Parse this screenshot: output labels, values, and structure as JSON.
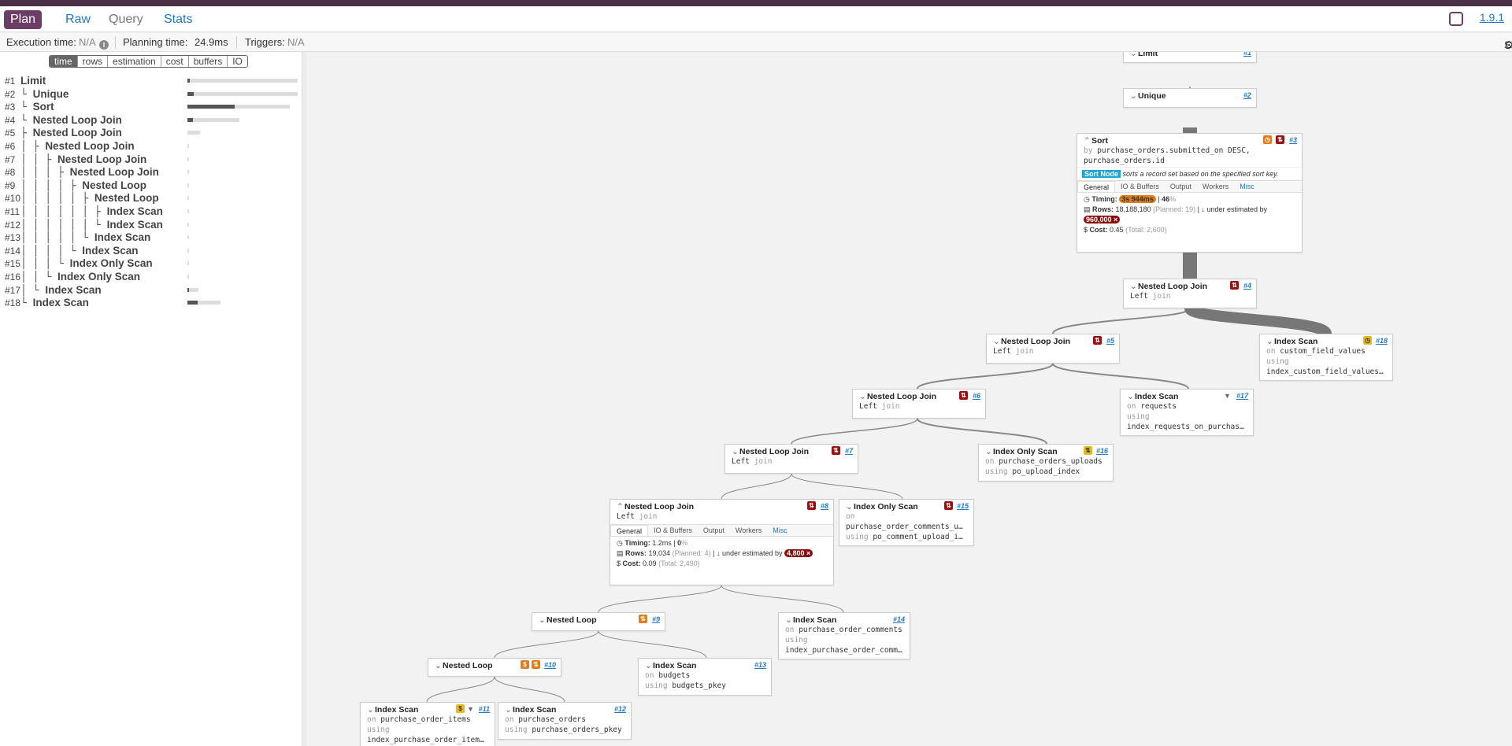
{
  "nav": {
    "tabs": [
      "Plan",
      "Raw",
      "Query",
      "Stats"
    ],
    "version": "1.9.1"
  },
  "info": {
    "exec_label": "Execution time:",
    "exec_value": "N/A",
    "plan_label": "Planning time:",
    "plan_value": "24.9ms",
    "trig_label": "Triggers:",
    "trig_value": "N/A",
    "settings": "Settings"
  },
  "metrics": [
    "time",
    "rows",
    "estimation",
    "cost",
    "buffers",
    "IO"
  ],
  "tree": [
    {
      "n": "#1",
      "label": "Limit",
      "guide": "",
      "fill": 0.02
    },
    {
      "n": "#2",
      "label": "Unique",
      "guide": "└ ",
      "fill": 0.06
    },
    {
      "n": "#3",
      "label": "Sort",
      "guide": "  └ ",
      "fill": 0.46
    },
    {
      "n": "#4",
      "label": "Nested Loop Join",
      "guide": "    └ ",
      "fill": 0.1
    },
    {
      "n": "#5",
      "label": "Nested Loop Join",
      "guide": "      ├ ",
      "fill": 0.0
    },
    {
      "n": "#6",
      "label": "Nested Loop Join",
      "guide": "      │ ├ ",
      "fill": 0.0
    },
    {
      "n": "#7",
      "label": "Nested Loop Join",
      "guide": "      │ │ ├ ",
      "fill": 0.0
    },
    {
      "n": "#8",
      "label": "Nested Loop Join",
      "guide": "      │ │ │ ├ ",
      "fill": 0.0
    },
    {
      "n": "#9",
      "label": "Nested Loop",
      "guide": "      │ │ │ │ ├ ",
      "fill": 0.0
    },
    {
      "n": "#10",
      "label": "Nested Loop",
      "guide": "      │ │ │ │ │ ├ ",
      "fill": 0.0
    },
    {
      "n": "#11",
      "label": "Index Scan",
      "guide": "      │ │ │ │ │ │ ├ ",
      "fill": 0.0
    },
    {
      "n": "#12",
      "label": "Index Scan",
      "guide": "      │ │ │ │ │ │ └ ",
      "fill": 0.0
    },
    {
      "n": "#13",
      "label": "Index Scan",
      "guide": "      │ │ │ │ │ └ ",
      "fill": 0.0
    },
    {
      "n": "#14",
      "label": "Index Scan",
      "guide": "      │ │ │ │ └ ",
      "fill": 0.0
    },
    {
      "n": "#15",
      "label": "Index Only Scan",
      "guide": "      │ │ │ └ ",
      "fill": 0.0
    },
    {
      "n": "#16",
      "label": "Index Only Scan",
      "guide": "      │ │ └ ",
      "fill": 0.0
    },
    {
      "n": "#17",
      "label": "Index Scan",
      "guide": "      │ └ ",
      "fill": 0.12
    },
    {
      "n": "#18",
      "label": "Index Scan",
      "guide": "      └ ",
      "fill": 0.3
    }
  ],
  "nodes": {
    "n1": {
      "title": "Limit",
      "num": "#1"
    },
    "n2": {
      "title": "Unique",
      "num": "#2"
    },
    "n3": {
      "title": "Sort",
      "num": "#3",
      "by_k": "by",
      "by": "purchase_orders.submitted_on DESC,",
      "by2": "purchase_orders.id",
      "tag": "Sort Node",
      "desc": "sorts a record set based on the specified sort key.",
      "tabs": [
        "General",
        "IO & Buffers",
        "Output",
        "Workers",
        "Misc"
      ],
      "timing_l": "Timing:",
      "timing": "3s 944ms",
      "timing_pct": "46",
      "rows_l": "Rows:",
      "rows": "18,188,180",
      "planned": "(Planned: 19)",
      "under": "under estimated by",
      "factor": "960,000 ×",
      "cost_l": "Cost:",
      "cost": "0.45",
      "total": "(Total: 2,600)"
    },
    "n4": {
      "title": "Nested Loop Join",
      "num": "#4",
      "sub": "Left",
      "subk": "join"
    },
    "n5": {
      "title": "Nested Loop Join",
      "num": "#5",
      "sub": "Left",
      "subk": "join"
    },
    "n6": {
      "title": "Nested Loop Join",
      "num": "#6",
      "sub": "Left",
      "subk": "join"
    },
    "n7": {
      "title": "Nested Loop Join",
      "num": "#7",
      "sub": "Left",
      "subk": "join"
    },
    "n8": {
      "title": "Nested Loop Join",
      "num": "#8",
      "sub": "Left",
      "subk": "join",
      "tabs": [
        "General",
        "IO & Buffers",
        "Output",
        "Workers",
        "Misc"
      ],
      "timing_l": "Timing:",
      "timing": "1.2ms",
      "timing_pct": "0",
      "rows_l": "Rows:",
      "rows": "19,034",
      "planned": "(Planned: 4)",
      "under": "under estimated by",
      "factor": "4,800 ×",
      "cost_l": "Cost:",
      "cost": "0.09",
      "total": "(Total: 2,490)"
    },
    "n9": {
      "title": "Nested Loop",
      "num": "#9"
    },
    "n10": {
      "title": "Nested Loop",
      "num": "#10"
    },
    "n11": {
      "title": "Index Scan",
      "num": "#11",
      "on": "purchase_order_items",
      "using": "index_purchase_order_items_on_..."
    },
    "n12": {
      "title": "Index Scan",
      "num": "#12",
      "on": "purchase_orders",
      "using": "purchase_orders_pkey"
    },
    "n13": {
      "title": "Index Scan",
      "num": "#13",
      "on": "budgets",
      "using": "budgets_pkey"
    },
    "n14": {
      "title": "Index Scan",
      "num": "#14",
      "on": "purchase_order_comments",
      "using": "index_purchase_order_comments..."
    },
    "n15": {
      "title": "Index Only Scan",
      "num": "#15",
      "on": "purchase_order_comments_uploa...",
      "using": "po_comment_upload_index"
    },
    "n16": {
      "title": "Index Only Scan",
      "num": "#16",
      "on": "purchase_orders_uploads",
      "using": "po_upload_index"
    },
    "n17": {
      "title": "Index Scan",
      "num": "#17",
      "on": "requests",
      "using": "index_requests_on_purchase_or..."
    },
    "n18": {
      "title": "Index Scan",
      "num": "#18",
      "on": "custom_field_values",
      "using": "index_custom_field_values_on_..."
    }
  },
  "kw": {
    "on": "on",
    "using": "using"
  }
}
